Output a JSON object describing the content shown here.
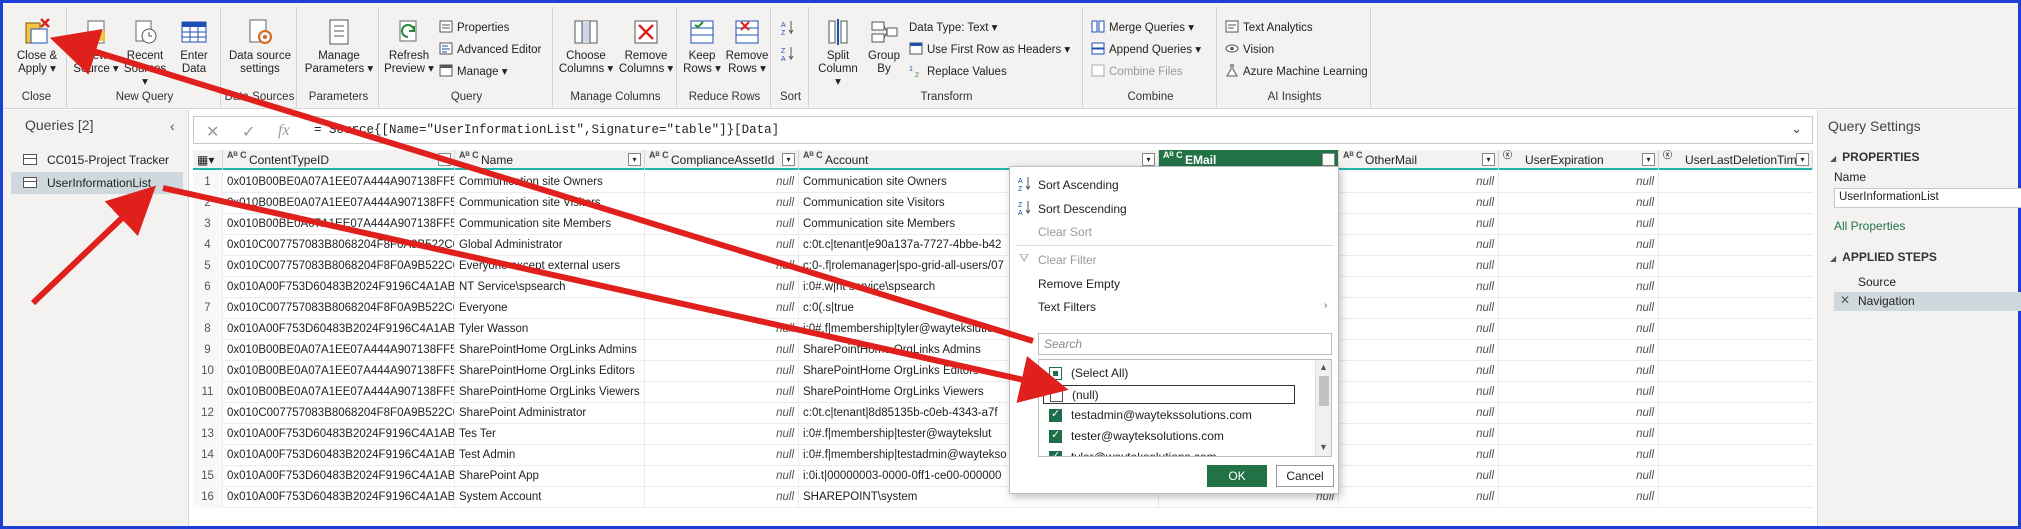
{
  "ribbon": {
    "groups": {
      "close": "Close",
      "new_query": "New Query",
      "data_sources": "Data Sources",
      "parameters": "Parameters",
      "query": "Query",
      "manage_columns": "Manage Columns",
      "reduce_rows": "Reduce Rows",
      "sort": "Sort",
      "transform": "Transform",
      "combine": "Combine",
      "ai_insights": "AI Insights"
    },
    "close_apply": [
      "Close &",
      "Apply ▾"
    ],
    "new_source": [
      "New",
      "Source ▾"
    ],
    "recent_sources": [
      "Recent",
      "Sources ▾"
    ],
    "enter_data": [
      "Enter",
      "Data"
    ],
    "data_source_settings": [
      "Data source",
      "settings"
    ],
    "manage_parameters": [
      "Manage",
      "Parameters ▾"
    ],
    "refresh_preview": [
      "Refresh",
      "Preview ▾"
    ],
    "properties": "Properties",
    "advanced_editor": "Advanced Editor",
    "manage": "Manage ▾",
    "choose_columns": [
      "Choose",
      "Columns ▾"
    ],
    "remove_columns": [
      "Remove",
      "Columns ▾"
    ],
    "keep_rows": [
      "Keep",
      "Rows ▾"
    ],
    "remove_rows": [
      "Remove",
      "Rows ▾"
    ],
    "split_column": [
      "Split",
      "Column ▾"
    ],
    "group_by": [
      "Group",
      "By"
    ],
    "data_type": "Data Type: Text ▾",
    "first_row_headers": "Use First Row as Headers ▾",
    "replace_values": "Replace Values",
    "merge_queries": "Merge Queries ▾",
    "append_queries": "Append Queries ▾",
    "combine_files": "Combine Files",
    "text_analytics": "Text Analytics",
    "vision": "Vision",
    "azure_ml": "Azure Machine Learning",
    "accent": "#217346"
  },
  "queries": {
    "title": "Queries [2]",
    "items": [
      "CC015-Project Tracker",
      "UserInformationList"
    ]
  },
  "formula": {
    "text": "= Source{[Name=\"UserInformationList\",Signature=\"table\"]}[Data]"
  },
  "grid": {
    "columns": [
      "ContentTypeID",
      "Name",
      "ComplianceAssetId",
      "Account",
      "EMail",
      "OtherMail",
      "UserExpiration",
      "UserLastDeletionTime"
    ],
    "rows": [
      [
        "1",
        "0x010B00BE0A07A1EE07A444A907138FF53...",
        "Communication site Owners",
        "null",
        "Communication site Owners",
        "",
        "null",
        "null"
      ],
      [
        "2",
        "0x010B00BE0A07A1EE07A444A907138FF53...",
        "Communication site Visitors",
        "null",
        "Communication site Visitors",
        "",
        "null",
        "null"
      ],
      [
        "3",
        "0x010B00BE0A07A1EE07A444A907138FF53...",
        "Communication site Members",
        "null",
        "Communication site Members",
        "",
        "null",
        "null"
      ],
      [
        "4",
        "0x010C007757083B8068204F8F0A9B522C06...",
        "Global Administrator",
        "null",
        "c:0t.c|tenant|e90a137a-7727-4bbe-b42",
        "",
        "null",
        "null"
      ],
      [
        "5",
        "0x010C007757083B8068204F8F0A9B522C06...",
        "Everyone except external users",
        "null",
        "c:0-.f|rolemanager|spo-grid-all-users/07",
        "",
        "null",
        "null"
      ],
      [
        "6",
        "0x010A00F753D60483B2024F9196C4A1AB0...",
        "NT Service\\spsearch",
        "null",
        "i:0#.w|nt service\\spsearch",
        "",
        "null",
        "null"
      ],
      [
        "7",
        "0x010C007757083B8068204F8F0A9B522C06...",
        "Everyone",
        "null",
        "c:0(.s|true",
        "",
        "null",
        "null"
      ],
      [
        "8",
        "0x010A00F753D60483B2024F9196C4A1AB0...",
        "Tyler Wasson",
        "null",
        "i:0#.f|membership|tyler@waytekslutio",
        "",
        "null",
        "null"
      ],
      [
        "9",
        "0x010B00BE0A07A1EE07A444A907138FF53...",
        "SharePointHome OrgLinks Admins",
        "null",
        "SharePointHome OrgLinks Admins",
        "",
        "null",
        "null"
      ],
      [
        "10",
        "0x010B00BE0A07A1EE07A444A907138FF53...",
        "SharePointHome OrgLinks Editors",
        "null",
        "SharePointHome OrgLinks Editors",
        "",
        "null",
        "null"
      ],
      [
        "11",
        "0x010B00BE0A07A1EE07A444A907138FF53...",
        "SharePointHome OrgLinks Viewers",
        "null",
        "SharePointHome OrgLinks Viewers",
        "",
        "null",
        "null"
      ],
      [
        "12",
        "0x010C007757083B8068204F8F0A9B522C06...",
        "SharePoint Administrator",
        "null",
        "c:0t.c|tenant|8d85135b-c0eb-4343-a7f",
        "",
        "null",
        "null"
      ],
      [
        "13",
        "0x010A00F753D60483B2024F9196C4A1AB0...",
        "Tes Ter",
        "null",
        "i:0#.f|membership|tester@waytekslut",
        "",
        "null",
        "null"
      ],
      [
        "14",
        "0x010A00F753D60483B2024F9196C4A1AB0...",
        "Test Admin",
        "null",
        "i:0#.f|membership|testadmin@waytekso",
        "",
        "null",
        "null"
      ],
      [
        "15",
        "0x010A00F753D60483B2024F9196C4A1AB0...",
        "SharePoint App",
        "null",
        "i:0i.t|00000003-0000-0ff1-ce00-000000",
        "",
        "null",
        "null"
      ],
      [
        "16",
        "0x010A00F753D60483B2024F9196C4A1AB0...",
        "System Account",
        "null",
        "SHAREPOINT\\system",
        "null",
        "null",
        "null"
      ]
    ]
  },
  "settings": {
    "title": "Query Settings",
    "properties": "PROPERTIES",
    "name_label": "Name",
    "name_value": "UserInformationList",
    "all_properties": "All Properties",
    "applied_steps": "APPLIED STEPS",
    "steps": [
      "Source",
      "Navigation"
    ]
  },
  "dropdown": {
    "sort_asc": "Sort Ascending",
    "sort_desc": "Sort Descending",
    "clear_sort": "Clear Sort",
    "clear_filter": "Clear Filter",
    "remove_empty": "Remove Empty",
    "text_filters": "Text Filters",
    "search_placeholder": "Search",
    "items": [
      {
        "label": "(Select All)",
        "state": "partial"
      },
      {
        "label": "(null)",
        "state": "off"
      },
      {
        "label": "testadmin@waytekssolutions.com",
        "state": "on"
      },
      {
        "label": "tester@wayteksolutions.com",
        "state": "on"
      },
      {
        "label": "tyler@wayteksolutions.com",
        "state": "on"
      }
    ],
    "ok": "OK",
    "cancel": "Cancel"
  },
  "colors": {
    "annotation_arrow": "#e0201c",
    "header_underline": "#1fb5a8",
    "active_column": "#217346"
  }
}
